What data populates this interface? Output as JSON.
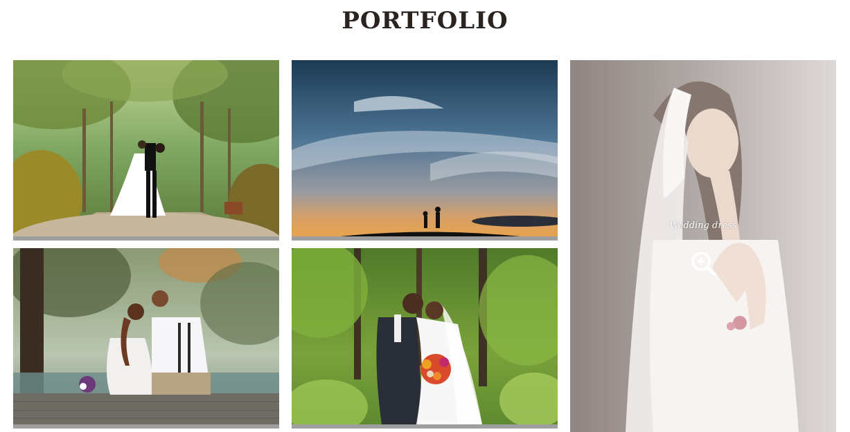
{
  "page": {
    "title": "PORTFOLIO"
  },
  "gallery": {
    "items": [
      {
        "icon": "image"
      },
      {
        "icon": "image"
      },
      {
        "icon": "image"
      },
      {
        "icon": "image"
      },
      {
        "icon": "image",
        "hovered": true,
        "caption": "Wedding dress",
        "action_icon": "zoom-in-icon"
      }
    ]
  },
  "colors": {
    "title": "#2b2320",
    "tile_base": "#9e9e9e",
    "overlay": "rgba(255,255,255,0.38)"
  }
}
